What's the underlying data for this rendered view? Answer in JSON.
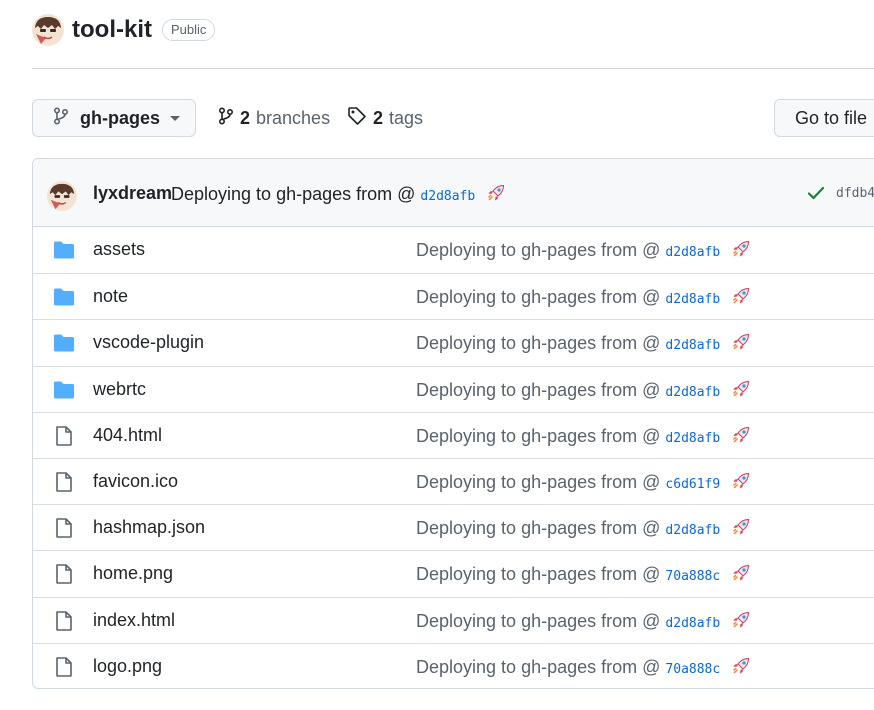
{
  "repo": {
    "name": "tool-kit",
    "visibility": "Public"
  },
  "toolbar": {
    "branch": "gh-pages",
    "branches_count": "2",
    "branches_label": "branches",
    "tags_count": "2",
    "tags_label": "tags",
    "goto_file": "Go to file"
  },
  "latest_commit": {
    "author": "lyxdream",
    "message": "Deploying to gh-pages from @",
    "sha": "d2d8afb",
    "emoji": "rocket-icon",
    "status": "success",
    "latest_sha": "dfdb4"
  },
  "files": [
    {
      "type": "folder",
      "name": "assets",
      "message": "Deploying to gh-pages from @",
      "sha": "d2d8afb"
    },
    {
      "type": "folder",
      "name": "note",
      "message": "Deploying to gh-pages from @",
      "sha": "d2d8afb"
    },
    {
      "type": "folder",
      "name": "vscode-plugin",
      "message": "Deploying to gh-pages from @",
      "sha": "d2d8afb"
    },
    {
      "type": "folder",
      "name": "webrtc",
      "message": "Deploying to gh-pages from @",
      "sha": "d2d8afb"
    },
    {
      "type": "file",
      "name": "404.html",
      "message": "Deploying to gh-pages from @",
      "sha": "d2d8afb"
    },
    {
      "type": "file",
      "name": "favicon.ico",
      "message": "Deploying to gh-pages from @",
      "sha": "c6d61f9"
    },
    {
      "type": "file",
      "name": "hashmap.json",
      "message": "Deploying to gh-pages from @",
      "sha": "d2d8afb"
    },
    {
      "type": "file",
      "name": "home.png",
      "message": "Deploying to gh-pages from @",
      "sha": "70a888c"
    },
    {
      "type": "file",
      "name": "index.html",
      "message": "Deploying to gh-pages from @",
      "sha": "d2d8afb"
    },
    {
      "type": "file",
      "name": "logo.png",
      "message": "Deploying to gh-pages from @",
      "sha": "70a888c"
    }
  ],
  "colors": {
    "folder": "#54aeff",
    "file": "#59636e",
    "link": "#0969da",
    "success": "#1a7f37"
  }
}
